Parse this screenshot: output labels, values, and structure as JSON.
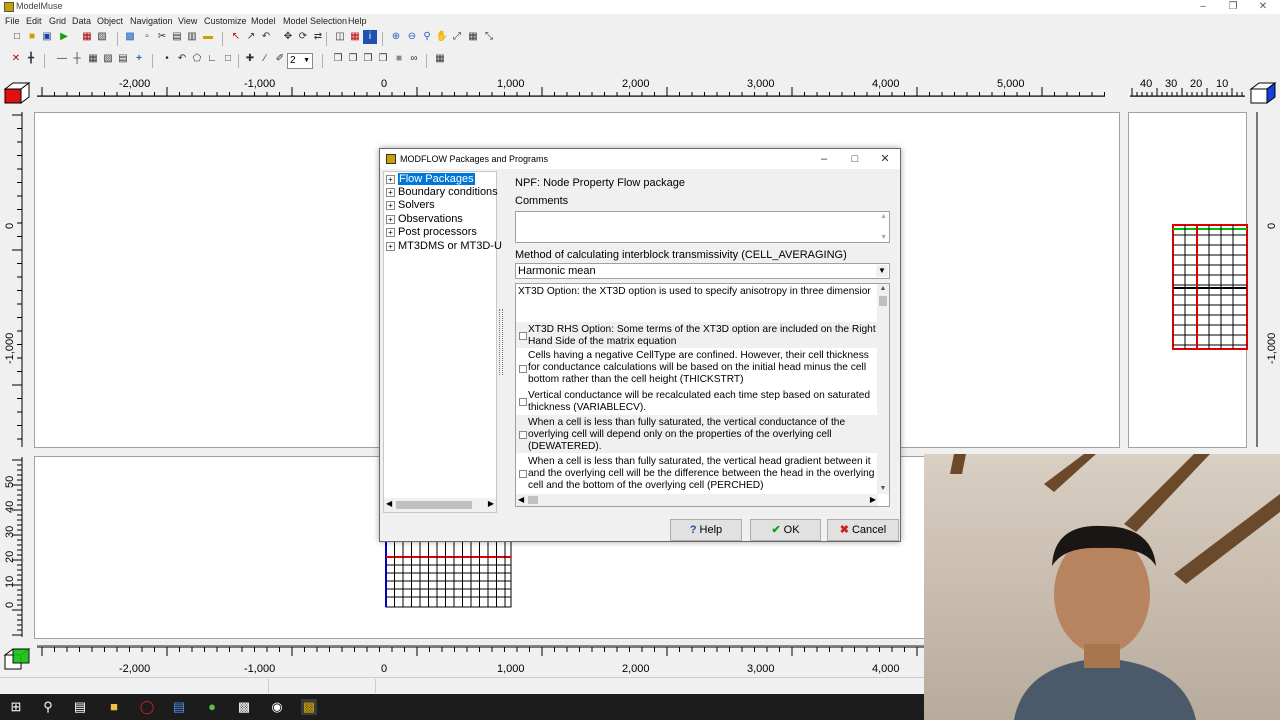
{
  "app": {
    "title": "ModelMuse"
  },
  "menu": [
    "File",
    "Edit",
    "Grid",
    "Data",
    "Object",
    "Navigation",
    "View",
    "Customize",
    "Model",
    "Model Selection",
    "Help"
  ],
  "toolbar": {
    "layer_value": "2"
  },
  "top_ruler": {
    "ticks": [
      "-2,000",
      "-1,000",
      "0",
      "1,000",
      "2,000",
      "3,000",
      "4,000",
      "5,000"
    ]
  },
  "side_ruler": {
    "ticks": [
      "40",
      "30",
      "20",
      "10"
    ]
  },
  "left_ruler": {
    "ticks": [
      "0",
      "-1,000"
    ]
  },
  "right_ruler": {
    "ticks": [
      "0",
      "-1,000"
    ]
  },
  "front_ruler": {
    "ticks": [
      "50",
      "40",
      "30",
      "20",
      "10",
      "0"
    ]
  },
  "bottom_ruler": {
    "ticks": [
      "-2,000",
      "-1,000",
      "0",
      "1,000",
      "2,000",
      "3,000",
      "4,000"
    ]
  },
  "dialog": {
    "title": "MODFLOW Packages and Programs",
    "tree": [
      {
        "label": "Flow Packages",
        "selected": true
      },
      {
        "label": "Boundary conditions",
        "selected": false
      },
      {
        "label": "Solvers",
        "selected": false
      },
      {
        "label": "Observations",
        "selected": false
      },
      {
        "label": "Post processors",
        "selected": false
      },
      {
        "label": "MT3DMS or MT3D-U",
        "selected": false
      }
    ],
    "package_title": "NPF: Node Property Flow package",
    "comments_label": "Comments",
    "method_label": "Method of calculating interblock transmissivity (CELL_AVERAGING)",
    "method_value": "Harmonic mean",
    "options": [
      {
        "text": "XT3D Option: the XT3D option is used to specify anisotropy in three dimensior"
      },
      {
        "text": "XT3D RHS Option: Some terms of the XT3D option are included on the Right Hand Side of the matrix equation"
      },
      {
        "text": "Cells having a negative CellType are confined. However, their cell thickness for conductance calculations will be based on the initial head minus the cell bottom rather than the cell height (THICKSTRT)"
      },
      {
        "text": "Vertical conductance will be recalculated each time step based on saturated thickness (VARIABLECV)."
      },
      {
        "text": "When a cell is less than fully saturated, the vertical conductance of the overlying cell will depend only on the properties of the overlying cell (DEWATERED)."
      },
      {
        "text": "When a cell is less than fully saturated, the vertical head gradient between it and the overlying cell will be the difference between the head in the overlying cell and the bottom of the overlying cell (PERCHED)"
      }
    ],
    "buttons": {
      "help": "Help",
      "ok": "OK",
      "cancel": "Cancel"
    }
  },
  "colors": {
    "selection": "#0078d7",
    "grid_red": "#e00000",
    "grid_green": "#00c000",
    "grid_blue": "#0000cc"
  }
}
